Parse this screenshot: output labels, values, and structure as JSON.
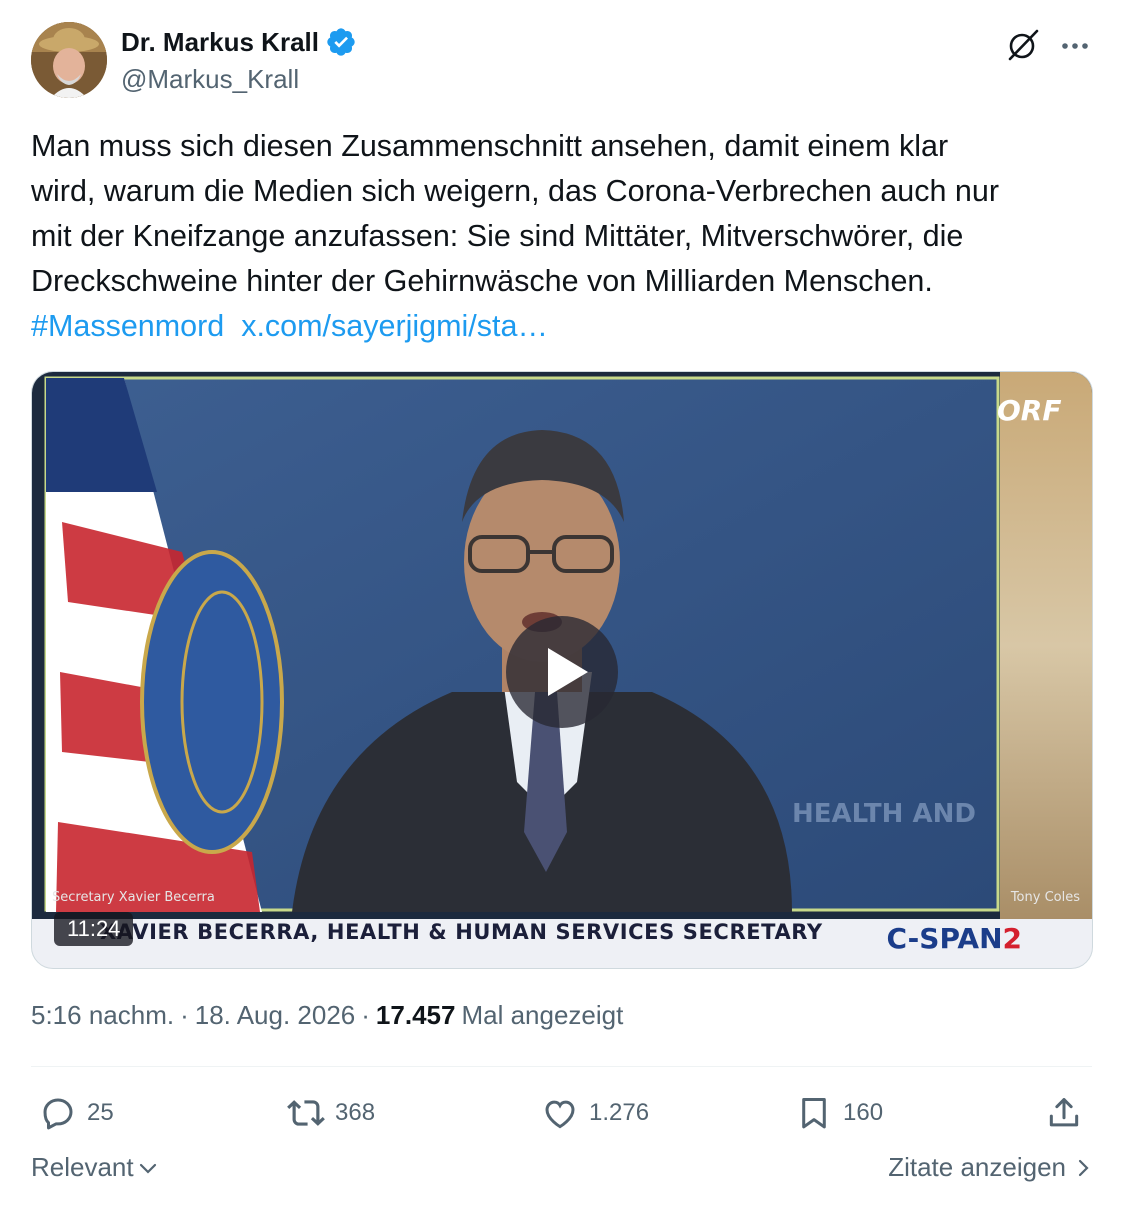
{
  "author": {
    "name": "Dr. Markus Krall",
    "handle": "@Markus_Krall",
    "verified_color": "#1d9bf0"
  },
  "icons": {
    "grok": "grok-icon",
    "more": "more-icon",
    "verified": "verified-badge-icon"
  },
  "tweet": {
    "text_lines": [
      "Man muss sich diesen Zusammenschnitt ansehen, damit einem klar",
      "wird, warum die Medien sich weigern, das Corona-Verbrechen auch nur",
      "mit der Kneifzange anzufassen: Sie sind Mittäter, Mitverschwörer, die",
      "Dreckschweine hinter der Gehirnwäsche von Milliarden Menschen."
    ],
    "hashtag": "#Massenmord",
    "link": "x.com/sayerjigmi/sta…"
  },
  "video": {
    "duration": "11:24",
    "chyron": "XAVIER BECERRA, HEALTH & HUMAN SERVICES SECRETARY",
    "network_main": "C-SPAN",
    "network_suffix": "2",
    "lower_left_label": "Secretary Xavier Becerra",
    "lower_right_label": "Tony Coles",
    "corner_text": "ORF",
    "backdrop_text": "HEALTH AND"
  },
  "meta": {
    "time": "5:16 nachm.",
    "date": "18. Aug. 2026",
    "views_count": "17.457",
    "views_label": "Mal angezeigt",
    "separator": "·"
  },
  "actions": {
    "replies": "25",
    "reposts": "368",
    "likes": "1.276",
    "bookmarks": "160"
  },
  "footer": {
    "sort_label": "Relevant",
    "quotes_label": "Zitate anzeigen"
  },
  "colors": {
    "text_primary": "#0f1419",
    "text_secondary": "#536471",
    "link": "#1d9bf0",
    "divider": "#eff3f4"
  }
}
